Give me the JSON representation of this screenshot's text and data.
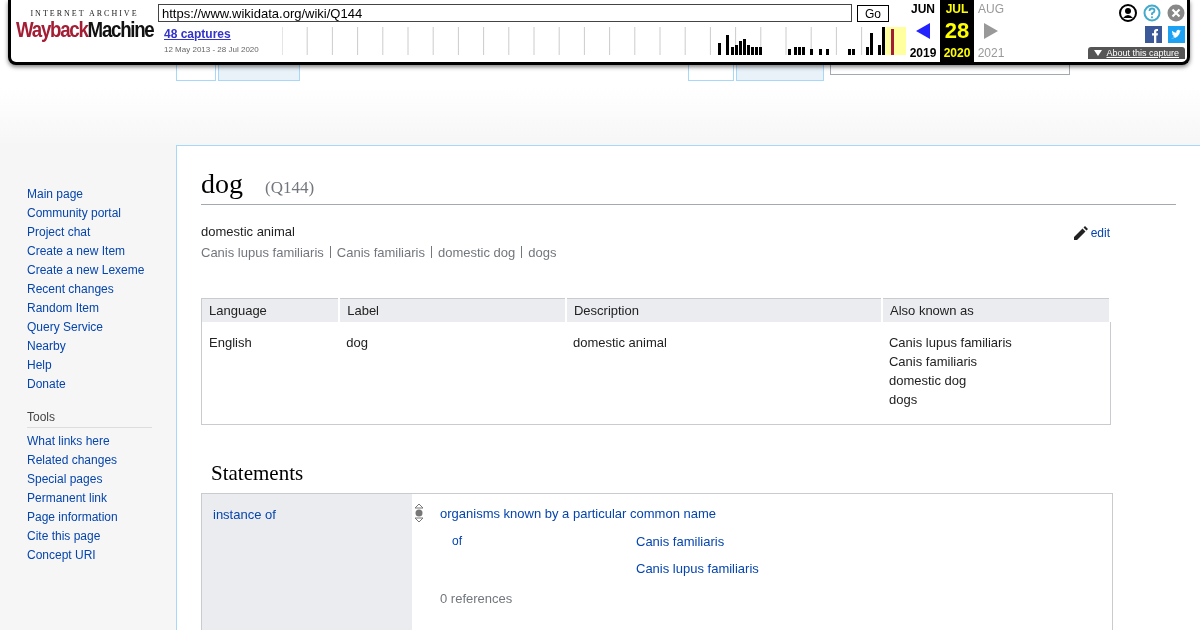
{
  "wayback": {
    "logo_top": "INTERNET ARCHIVE",
    "wordmark": [
      "Wayback",
      "Machine"
    ],
    "url": "https://www.wikidata.org/wiki/Q144",
    "go": "Go",
    "captures": "48 captures",
    "range": "12 May 2013 - 28 Jul 2020",
    "months": [
      {
        "month": "JUN",
        "year": "2019",
        "selected": false,
        "disabled": false
      },
      {
        "month": "JUL",
        "day": "28",
        "year": "2020",
        "selected": true,
        "disabled": false
      },
      {
        "month": "AUG",
        "year": "2021",
        "selected": false,
        "disabled": true
      }
    ],
    "about": "About this capture"
  },
  "page_tabs": [
    {
      "selected": true
    },
    {
      "selected": false
    }
  ],
  "view_tabs": [
    {
      "selected": true
    },
    {
      "selected": false
    }
  ],
  "sidebar": {
    "navigation": [
      "Main page",
      "Community portal",
      "Project chat",
      "Create a new Item",
      "Create a new Lexeme",
      "Recent changes",
      "Random Item",
      "Query Service",
      "Nearby",
      "Help",
      "Donate"
    ],
    "tools": {
      "heading": "Tools",
      "items": [
        "What links here",
        "Related changes",
        "Special pages",
        "Permanent link",
        "Page information",
        "Cite this page",
        "Concept URI"
      ]
    }
  },
  "entity": {
    "label": "dog",
    "id": "(Q144)",
    "description": "domestic animal",
    "aliases": [
      "Canis lupus familiaris",
      "Canis familiaris",
      "domestic dog",
      "dogs"
    ],
    "edit": "edit"
  },
  "terms_table": {
    "columns": [
      "Language",
      "Label",
      "Description",
      "Also known as"
    ],
    "rows": [
      {
        "language": "English",
        "label": "dog",
        "description": "domestic animal",
        "aliases": [
          "Canis lupus familiaris",
          "Canis familiaris",
          "domestic dog",
          "dogs"
        ]
      }
    ]
  },
  "statements": {
    "heading": "Statements",
    "groups": [
      {
        "property": "instance of",
        "statements": [
          {
            "value": "organisms known by a particular common name",
            "qualifiers": [
              {
                "property": "of",
                "values": [
                  "Canis familiaris",
                  "Canis lupus familiaris"
                ]
              }
            ],
            "references": "0 references"
          }
        ]
      }
    ]
  }
}
